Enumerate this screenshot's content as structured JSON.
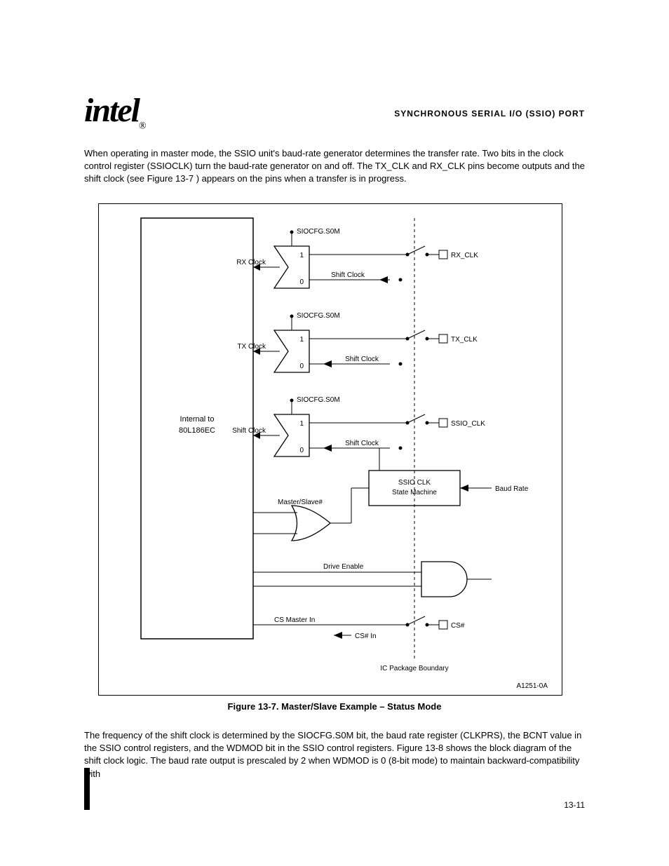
{
  "header": {
    "logo_text": "intel",
    "logo_sub": "®",
    "doc_title": "SYNCHRONOUS SERIAL I/O (SSIO) PORT"
  },
  "paras": {
    "p1_a": "When operating in master mode, the SSIO unit's baud-rate generator determines the transfer rate. Two bits in the clock control register (SSIOCLK) turn the baud-rate generator on and off. The TX_CLK and RX_CLK pins become outputs and the shift clock (see ",
    "p1_link": "Figure 13-7",
    "p1_b": ") appears on the pins when a transfer is in progress.",
    "p2": "The frequency of the shift clock is determined by the SIOCFG.S0M bit, the baud rate register (CLKPRS), the BCNT value in the SSIO control registers, and the WDMOD bit in the SSIO control registers. Figure 13-8 shows the block diagram of the shift clock logic. The baud rate output is prescaled by 2 when WDMOD is 0 (8-bit mode) to maintain backward-compatibility with",
    "caption": "Figure 13-7.  Master/Slave Example – Status Mode"
  },
  "diagram": {
    "block": "Internal to 80L186EC",
    "mux_labels": {
      "one": "1",
      "zero": "0",
      "control": "SIOCFG.S0M"
    },
    "signals": {
      "rx_clock": "RX Clock",
      "tx_clock": "TX Clock",
      "shift_clock": "Shift Clock",
      "master_slave_n": "Master/Slave#",
      "drive_enable": "Drive Enable",
      "state_machine": "SSIO CLK State Machine",
      "baud_rate": "Baud Rate",
      "cs_master": "CS Master In",
      "cs_in": "CS# In"
    },
    "pins": {
      "rx_clk": "RX_CLK",
      "tx_clk": "TX_CLK",
      "ssio_clk": "SSIO_CLK",
      "cs": "CS#"
    },
    "footer": "A1251-0A"
  },
  "page_number": "13-11"
}
